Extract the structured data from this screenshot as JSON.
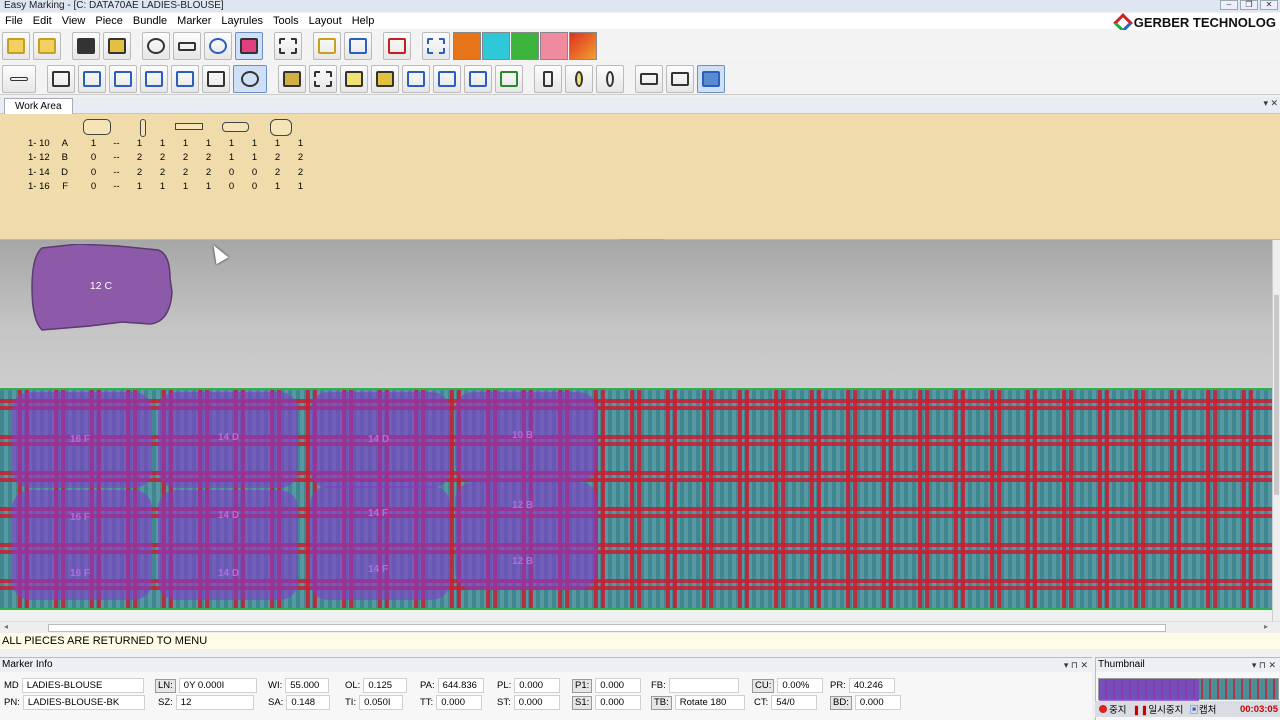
{
  "window": {
    "title": "Easy Marking - [C: DATA70AE LADIES-BLOUSE]"
  },
  "menu": [
    "File",
    "Edit",
    "View",
    "Piece",
    "Bundle",
    "Marker",
    "Layrules",
    "Tools",
    "Layout",
    "Help"
  ],
  "brand": "GERBER TECHNOLOG",
  "tab": {
    "label": "Work Area"
  },
  "piece_menu": {
    "rows": [
      {
        "size": "1- 10",
        "code": "A",
        "first": "1",
        "dash": "--",
        "qty": [
          "1",
          "1",
          "1",
          "1",
          "1",
          "1",
          "1",
          "1"
        ]
      },
      {
        "size": "1- 12",
        "code": "B",
        "first": "0",
        "dash": "--",
        "qty": [
          "2",
          "2",
          "2",
          "2",
          "1",
          "1",
          "2",
          "2"
        ]
      },
      {
        "size": "1- 14",
        "code": "D",
        "first": "0",
        "dash": "--",
        "qty": [
          "2",
          "2",
          "2",
          "2",
          "0",
          "0",
          "2",
          "2"
        ]
      },
      {
        "size": "1- 16",
        "code": "F",
        "first": "0",
        "dash": "--",
        "qty": [
          "1",
          "1",
          "1",
          "1",
          "0",
          "0",
          "1",
          "1"
        ]
      }
    ]
  },
  "selected_piece": {
    "label": "12 C"
  },
  "laid_pieces": [
    "16 F",
    "14 D",
    "14 D",
    "10 B",
    "16 F",
    "14 D",
    "14 F",
    "12 B",
    "16 F",
    "14 D",
    "14 F",
    "12 B"
  ],
  "status": "ALL PIECES ARE RETURNED TO MENU",
  "marker_info": {
    "title": "Marker Info",
    "MD": "LADIES-BLOUSE",
    "PN": "LADIES-BLOUSE-BK",
    "LN": "0Y 0.000I",
    "SZ": "12",
    "WI": "55.000",
    "SA": "0.148",
    "OL": "0.125",
    "TI": "0.050I",
    "PA": "644.836",
    "TT": "0.000",
    "PL": "0.000",
    "ST": "0.000",
    "P1": "0.000",
    "S1": "0.000",
    "FB": "",
    "TB": "Rotate 180",
    "CU": "0.00%",
    "CT": "54/0",
    "PR": "40.246",
    "BD": "0.000"
  },
  "thumbnail": {
    "title": "Thumbnail"
  },
  "recorder": {
    "stop": "중지",
    "pause": "일시중지",
    "capture": "캡처",
    "time": "00:03:05"
  },
  "colors": {
    "menu_bg": "#f0dcaa",
    "fabric": "#4a8e98",
    "plaid": "#c81e32",
    "piece": "#8c4fc8",
    "status_time": "#cc0000"
  }
}
